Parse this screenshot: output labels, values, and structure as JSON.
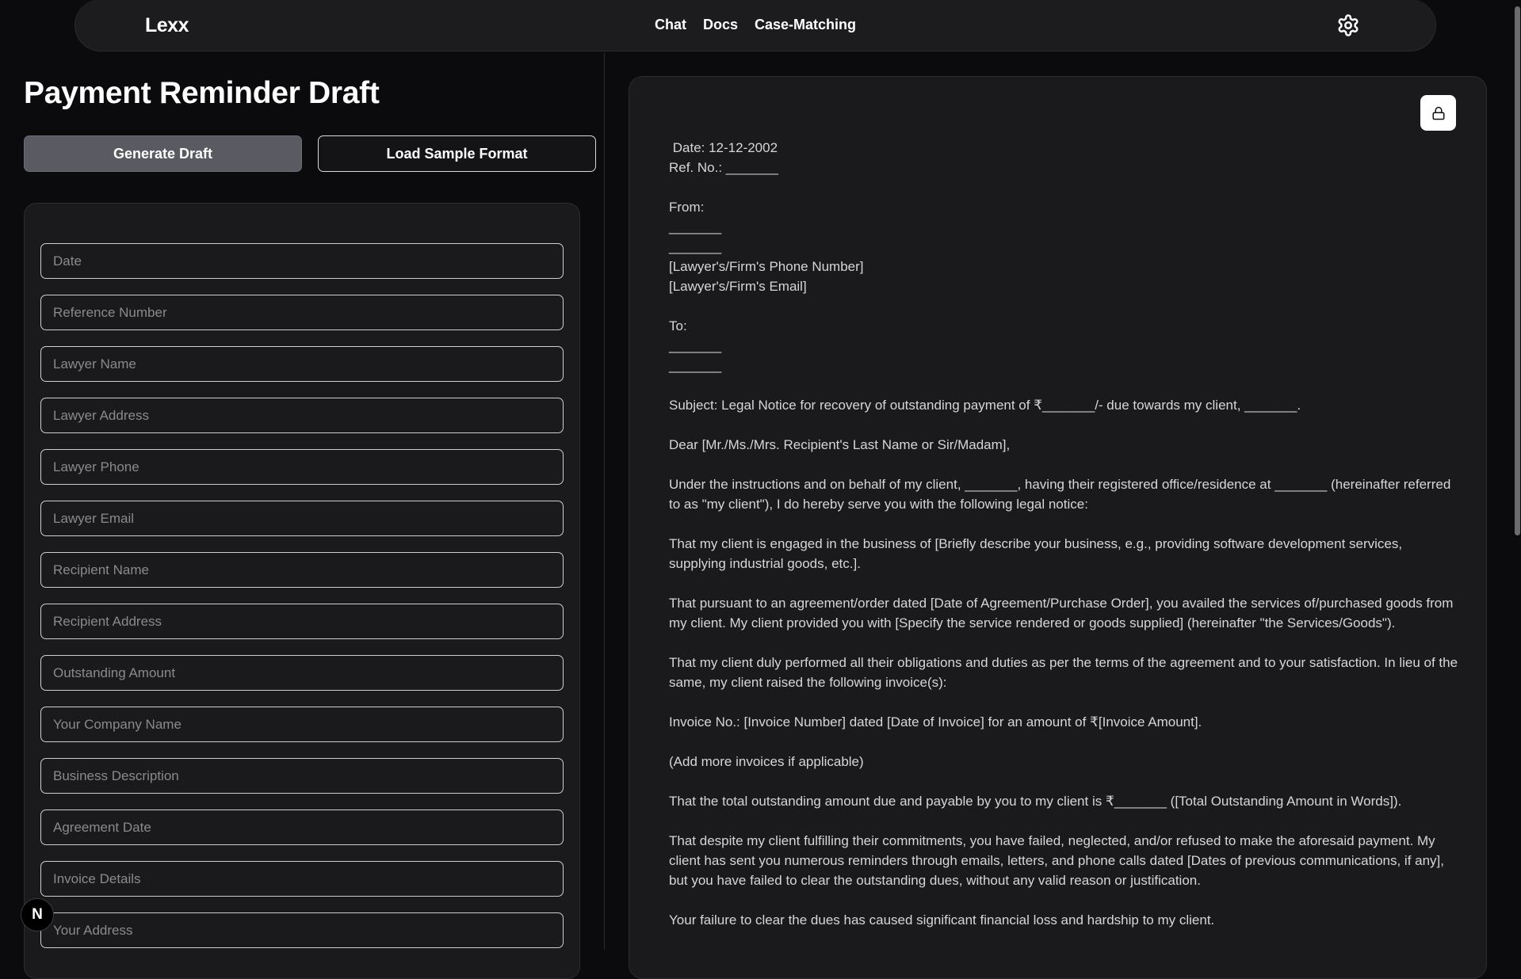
{
  "nav": {
    "brand": "Lexx",
    "links": [
      "Chat",
      "Docs",
      "Case-Matching"
    ],
    "settings_icon": "gear-icon"
  },
  "left": {
    "title": "Payment Reminder Draft",
    "generate_label": "Generate Draft",
    "sample_label": "Load Sample Format",
    "fields": [
      "Date",
      "Reference Number",
      "Lawyer Name",
      "Lawyer Address",
      "Lawyer Phone",
      "Lawyer Email",
      "Recipient Name",
      "Recipient Address",
      "Outstanding Amount",
      "Your Company Name",
      "Business Description",
      "Agreement Date",
      "Invoice Details",
      "Your Address"
    ]
  },
  "document": {
    "lock_icon": "lock-icon",
    "paragraphs": [
      " Date: 12-12-2002\nRef. No.: _______",
      "From:\n_______\n_______\n[Lawyer's/Firm's Phone Number]\n[Lawyer's/Firm's Email]",
      "To:\n_______\n_______",
      "Subject: Legal Notice for recovery of outstanding payment of ₹_______/- due towards my client, _______.",
      "Dear [Mr./Ms./Mrs. Recipient's Last Name or Sir/Madam],",
      "Under the instructions and on behalf of my client, _______, having their registered office/residence at _______ (hereinafter referred to as \"my client\"), I do hereby serve you with the following legal notice:",
      "That my client is engaged in the business of [Briefly describe your business, e.g., providing software development services, supplying industrial goods, etc.].",
      "That pursuant to an agreement/order dated [Date of Agreement/Purchase Order], you availed the services of/purchased goods from my client. My client provided you with [Specify the service rendered or goods supplied] (hereinafter \"the Services/Goods\").",
      "That my client duly performed all their obligations and duties as per the terms of the agreement and to your satisfaction. In lieu of the same, my client raised the following invoice(s):",
      "Invoice No.: [Invoice Number] dated [Date of Invoice] for an amount of ₹[Invoice Amount].",
      "(Add more invoices if applicable)",
      "That the total outstanding amount due and payable by you to my client is ₹_______ ([Total Outstanding Amount in Words]).",
      "That despite my client fulfilling their commitments, you have failed, neglected, and/or refused to make the aforesaid payment. My client has sent you numerous reminders through emails, letters, and phone calls dated [Dates of previous communications, if any], but you have failed to clear the outstanding dues, without any valid reason or justification.",
      "Your failure to clear the dues has caused significant financial loss and hardship to my client."
    ]
  },
  "badge": {
    "label": "N"
  }
}
